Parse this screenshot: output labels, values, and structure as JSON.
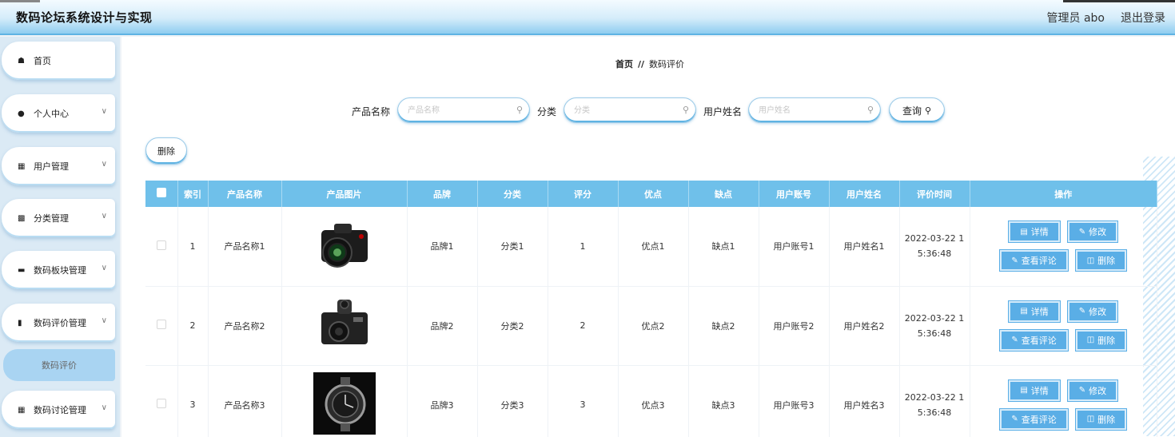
{
  "header": {
    "title": "数码论坛系统设计与实现",
    "admin": "管理员 abo",
    "logout": "退出登录"
  },
  "sidebar": {
    "items": [
      {
        "label": "首页",
        "icon": "home-icon",
        "glyph": "⌂"
      },
      {
        "label": "个人中心",
        "icon": "user-icon",
        "glyph": "●"
      },
      {
        "label": "用户管理",
        "icon": "grid-icon",
        "glyph": "▪"
      },
      {
        "label": "分类管理",
        "icon": "chart-icon",
        "glyph": "▮"
      },
      {
        "label": "数码板块管理",
        "icon": "layers-icon",
        "glyph": "▪"
      },
      {
        "label": "数码评价管理",
        "icon": "bar-chart-icon",
        "glyph": "▮"
      },
      {
        "label": "数码讨论管理",
        "icon": "grid-icon",
        "glyph": "▪"
      }
    ],
    "active_sub": "数码评价"
  },
  "breadcrumb": {
    "home": "首页",
    "sep": "//",
    "current": "数码评价"
  },
  "search": {
    "product_label": "产品名称",
    "product_placeholder": "产品名称",
    "category_label": "分类",
    "category_placeholder": "分类",
    "user_label": "用户姓名",
    "user_placeholder": "用户姓名",
    "query_label": "查询"
  },
  "delete_label": "删除",
  "table": {
    "headers": [
      "索引",
      "产品名称",
      "产品图片",
      "品牌",
      "分类",
      "评分",
      "优点",
      "缺点",
      "用户账号",
      "用户姓名",
      "评价时间",
      "操作"
    ],
    "rows": [
      {
        "index": "1",
        "name": "产品名称1",
        "brand": "品牌1",
        "category": "分类1",
        "score": "1",
        "pros": "优点1",
        "cons": "缺点1",
        "account": "用户账号1",
        "username": "用户姓名1",
        "time1": "2022-03-22 1",
        "time2": "5:36:48"
      },
      {
        "index": "2",
        "name": "产品名称2",
        "brand": "品牌2",
        "category": "分类2",
        "score": "2",
        "pros": "优点2",
        "cons": "缺点2",
        "account": "用户账号2",
        "username": "用户姓名2",
        "time1": "2022-03-22 1",
        "time2": "5:36:48"
      },
      {
        "index": "3",
        "name": "产品名称3",
        "brand": "品牌3",
        "category": "分类3",
        "score": "3",
        "pros": "优点3",
        "cons": "缺点3",
        "account": "用户账号3",
        "username": "用户姓名3",
        "time1": "2022-03-22 1",
        "time2": "5:36:48"
      }
    ],
    "ops": {
      "detail": "详情",
      "edit": "修改",
      "view_comments": "查看评论",
      "delete": "删除"
    }
  }
}
